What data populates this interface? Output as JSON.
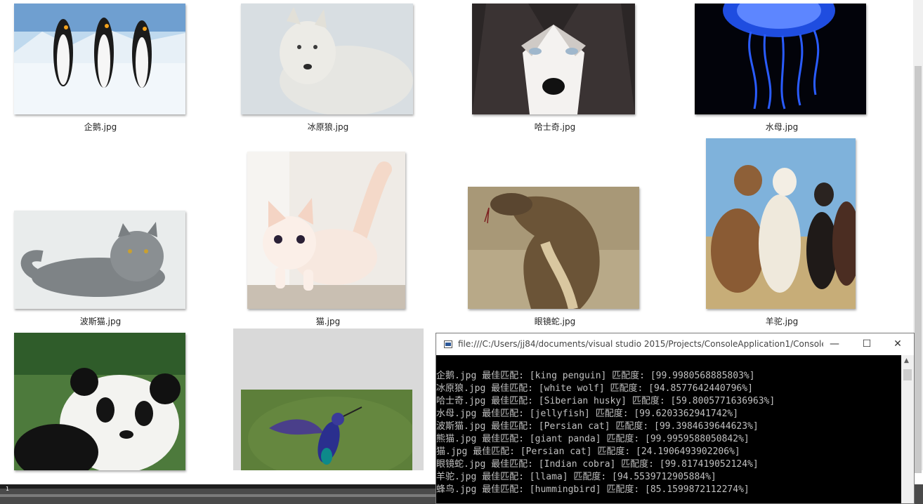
{
  "gallery": [
    {
      "file": "企鹅.jpg",
      "icon": "penguin-photo"
    },
    {
      "file": "冰原狼.jpg",
      "icon": "white-wolf-photo"
    },
    {
      "file": "哈士奇.jpg",
      "icon": "husky-photo"
    },
    {
      "file": "水母.jpg",
      "icon": "jellyfish-photo"
    },
    {
      "file": "波斯猫.jpg",
      "icon": "persian-cat-photo"
    },
    {
      "file": "猫.jpg",
      "icon": "kitten-photo"
    },
    {
      "file": "眼镜蛇.jpg",
      "icon": "cobra-photo"
    },
    {
      "file": "羊驼.jpg",
      "icon": "alpaca-photo"
    },
    {
      "file": "",
      "icon": "panda-photo"
    },
    {
      "file": "",
      "icon": "hummingbird-photo"
    }
  ],
  "console": {
    "title": "file:///C:/Users/jj84/documents/visual studio 2015/Projects/ConsoleApplication1/ConsoleAppli...",
    "minimize": "—",
    "maximize": "☐",
    "close": "✕",
    "lines": [
      "企鹅.jpg 最佳匹配: [king penguin] 匹配度: [99.9980568885803%]",
      "冰原狼.jpg 最佳匹配: [white wolf] 匹配度: [94.8577642440796%]",
      "哈士奇.jpg 最佳匹配: [Siberian husky] 匹配度: [59.8005771636963%]",
      "水母.jpg 最佳匹配: [jellyfish] 匹配度: [99.6203362941742%]",
      "波斯猫.jpg 最佳匹配: [Persian cat] 匹配度: [99.3984639644623%]",
      "熊猫.jpg 最佳匹配: [giant panda] 匹配度: [99.9959588050842%]",
      "猫.jpg 最佳匹配: [Persian cat] 匹配度: [24.1906493902206%]",
      "眼镜蛇.jpg 最佳匹配: [Indian cobra] 匹配度: [99.817419052124%]",
      "羊驼.jpg 最佳匹配: [llama] 匹配度: [94.5539712905884%]",
      "蜂鸟.jpg 最佳匹配: [hummingbird] 匹配度: [85.1599872112274%]"
    ]
  },
  "taskbar": {
    "label": "1"
  }
}
